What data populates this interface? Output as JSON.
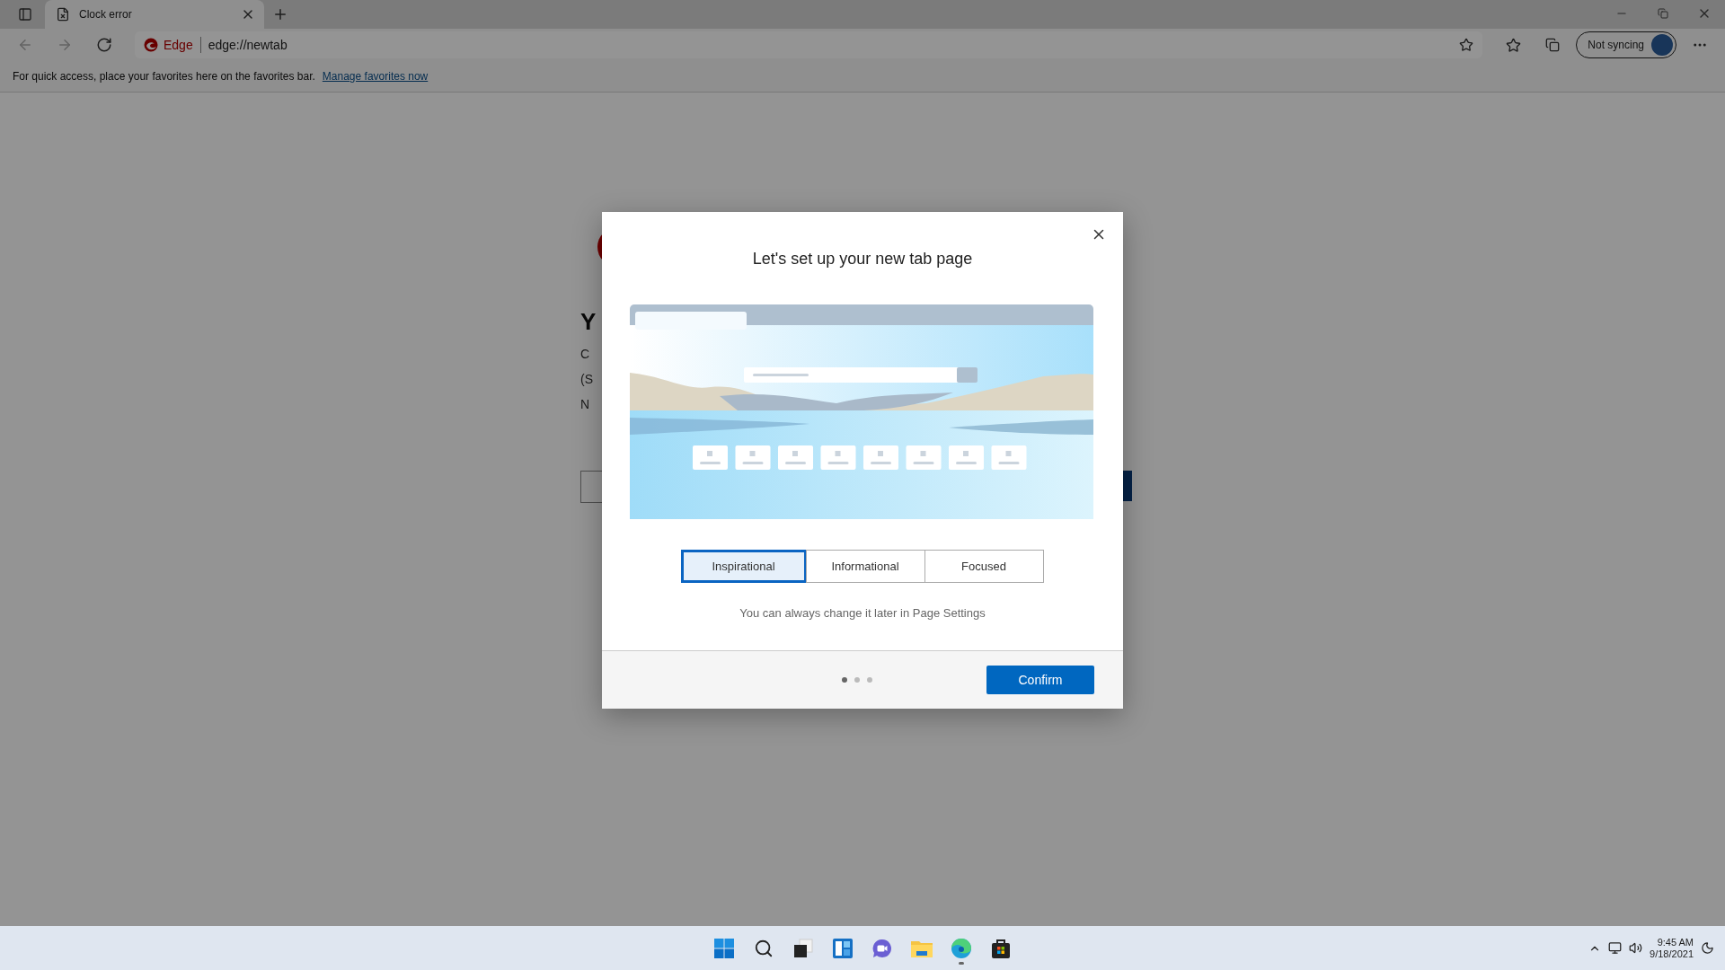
{
  "browser": {
    "tabs": [
      {
        "title": "Clock error",
        "selected": true
      }
    ],
    "address": {
      "site": "Edge",
      "url": "edge://newtab"
    },
    "sync": {
      "label": "Not syncing"
    },
    "favorites_bar": {
      "message": "For quick access, place your favorites here on the favorites bar.",
      "link": "Manage favorites now"
    }
  },
  "background_page": {
    "heading": "Y",
    "lines": [
      "C",
      "(S",
      "N"
    ]
  },
  "dialog": {
    "title": "Let's set up your new tab page",
    "layouts": [
      {
        "label": "Inspirational",
        "selected": true
      },
      {
        "label": "Informational",
        "selected": false
      },
      {
        "label": "Focused",
        "selected": false
      }
    ],
    "hint": "You can always change it later in Page Settings",
    "steps": [
      {
        "selected": true
      },
      {
        "selected": false
      },
      {
        "selected": false
      }
    ],
    "confirm": "Confirm"
  },
  "taskbar": {
    "apps": [
      {
        "kind": "start",
        "running": false
      },
      {
        "kind": "search",
        "running": false
      },
      {
        "kind": "task-view",
        "running": false
      },
      {
        "kind": "widgets",
        "running": false
      },
      {
        "kind": "chat",
        "running": false
      },
      {
        "kind": "files",
        "running": false
      },
      {
        "kind": "browser",
        "running": true
      },
      {
        "kind": "store",
        "running": false
      }
    ],
    "clock": {
      "time": "9:45 AM",
      "date": "9/18/2021"
    }
  }
}
